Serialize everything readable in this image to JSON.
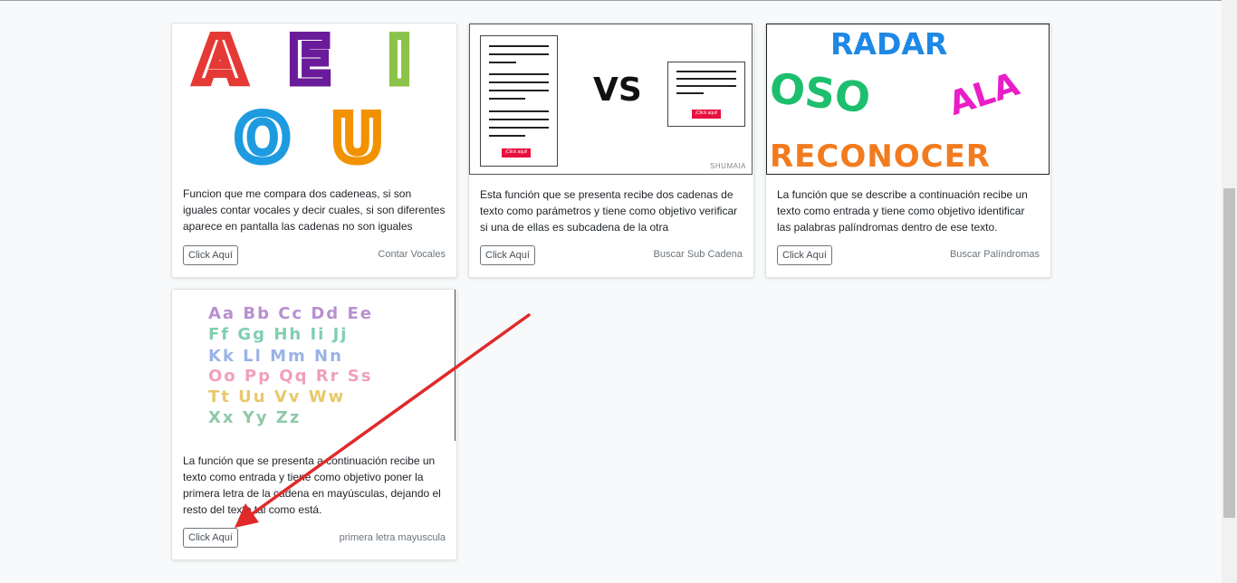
{
  "cards": [
    {
      "image_letters": [
        "A",
        "E",
        "I",
        "O",
        "U"
      ],
      "description": "Funcion que me compara dos cadeneas, si son iguales contar vocales y decir cuales, si son diferentes aparece en pantalla las cadenas no son iguales",
      "button_label": "Click Aquí",
      "name": "Contar Vocales"
    },
    {
      "image_vs": "VS",
      "image_btn": "¡Click aqui!",
      "image_watermark": "SHUMAIA",
      "description": "Esta función que se presenta recibe dos cadenas de texto como parámetros y tiene como objetivo verificar si una de ellas es subcadena de la otra",
      "button_label": "Click Aquí",
      "name": "Buscar Sub Cadena"
    },
    {
      "image_words": [
        "RADAR",
        "OSO",
        "ALA",
        "RECONOCER"
      ],
      "description": "La función que se describe a continuación recibe un texto como entrada y tiene como objetivo identificar las palabras palíndromas dentro de ese texto.",
      "button_label": "Click Aquí",
      "name": "Buscar Palíndromas"
    },
    {
      "image_alphabet": [
        "Aa Bb Cc Dd Ee",
        "Ff Gg Hh Ii Jj",
        "Kk Ll Mm Nn",
        "Oo Pp Qq Rr Ss",
        "Tt Uu Vv Ww",
        "Xx Yy Zz"
      ],
      "description": "La función que se presenta a continuación recibe un texto como entrada y tiene como objetivo poner la primera letra de la cadena en mayúsculas, dejando el resto del texto tal como está.",
      "button_label": "Click Aquí",
      "name": "primera letra mayuscula"
    }
  ],
  "colors": {
    "vowel_a": "#e53935",
    "vowel_e": "#6a1b9a",
    "vowel_i": "#8bc34a",
    "vowel_o": "#1e9be0",
    "vowel_u": "#f39200",
    "radar": "#1e88e5",
    "oso": "#1dbf6f",
    "ala": "#e91ec8",
    "reconocer": "#f27b1f",
    "annotation_arrow": "#e02a2a"
  }
}
